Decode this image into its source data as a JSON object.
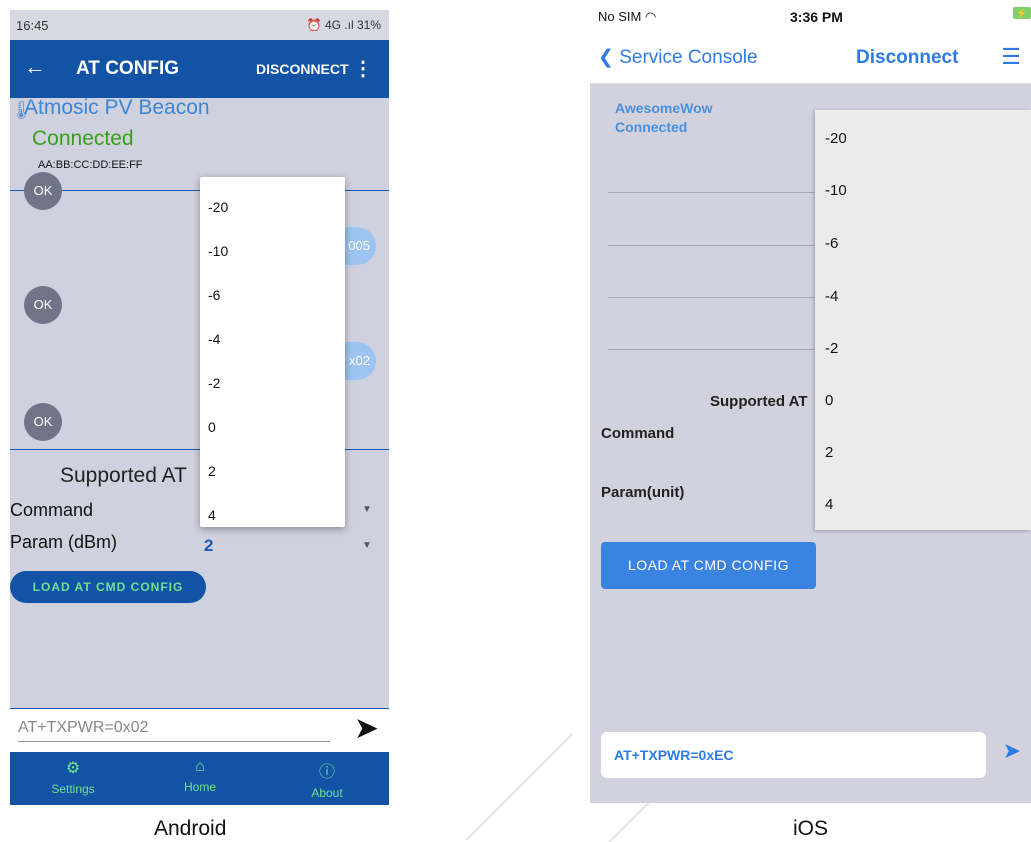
{
  "android": {
    "status_time": "16:45",
    "status_right": "⏰ 4G .ıl 31%",
    "appbar": {
      "title": "AT CONFIG",
      "disconnect": "DISCONNECT"
    },
    "device_name": "Atmosic PV Beacon",
    "status": "Connected",
    "mac": "AA:BB:CC:DD:EE:FF",
    "chat": [
      {
        "type": "ok",
        "label": "OK"
      },
      {
        "type": "resp",
        "label": "005"
      },
      {
        "type": "ok",
        "label": "OK"
      },
      {
        "type": "resp",
        "label": "x02"
      },
      {
        "type": "ok",
        "label": "OK"
      }
    ],
    "supported_label": "Supported AT",
    "command_label": "Command",
    "param_label": "Param (dBm)",
    "param_value": "2",
    "load_button": "LOAD AT CMD CONFIG",
    "input_value": "AT+TXPWR=0x02",
    "dropdown_options": [
      "-20",
      "-10",
      "-6",
      "-4",
      "-2",
      "0",
      "2",
      "4"
    ],
    "nav": [
      {
        "label": "Settings",
        "icon": "gear-icon"
      },
      {
        "label": "Home",
        "icon": "home-icon"
      },
      {
        "label": "About",
        "icon": "info-icon"
      }
    ],
    "caption": "Android"
  },
  "ios": {
    "status_sim": "No SIM",
    "status_time": "3:36 PM",
    "back_label": "Service Console",
    "disconnect": "Disconnect",
    "device_name": "AwesomeWow",
    "status": "Connected",
    "supported_label": "Supported AT",
    "command_label": "Command",
    "param_label": "Param(unit)",
    "load_button": "LOAD AT CMD CONFIG",
    "input_value": "AT+TXPWR=0xEC",
    "dropdown_options": [
      "-20",
      "-10",
      "-6",
      "-4",
      "-2",
      "0",
      "2",
      "4"
    ],
    "caption": "iOS"
  },
  "colors": {
    "android_primary": "#1353a6",
    "android_accent": "#6fe090",
    "ios_primary": "#2f7be5",
    "connected_green": "#3a9e1a"
  }
}
